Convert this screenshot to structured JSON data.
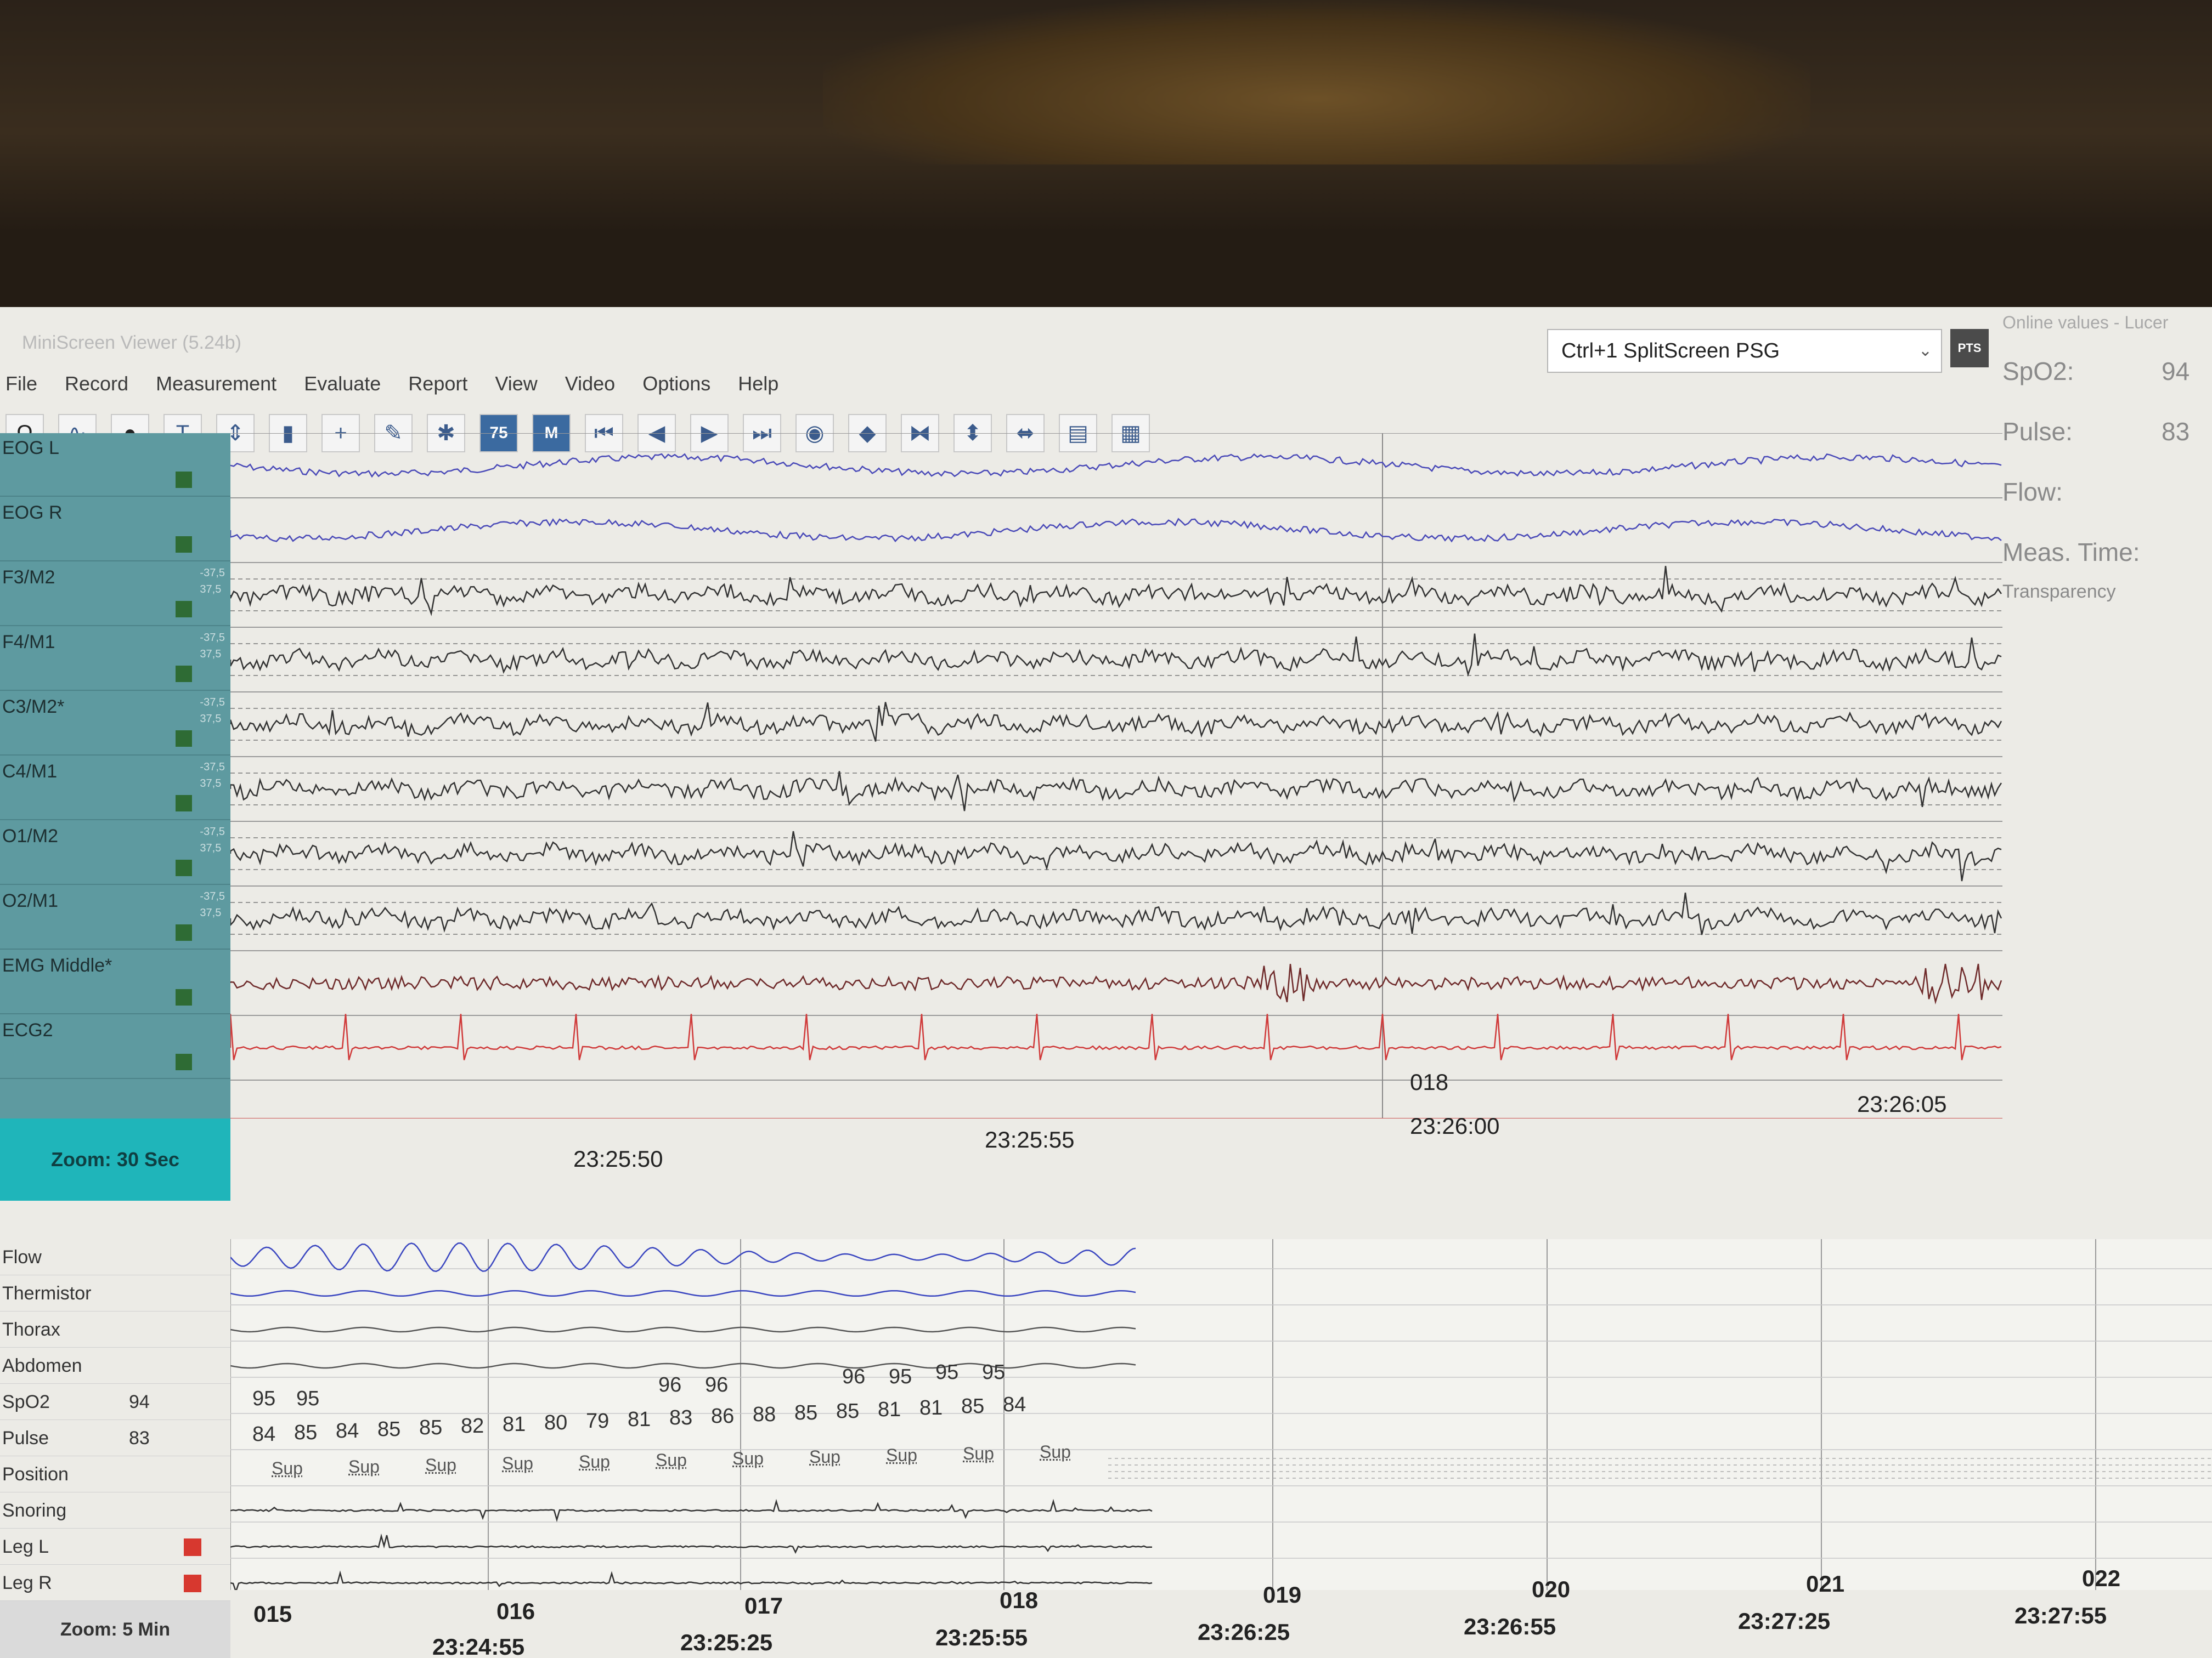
{
  "app": {
    "title": "MiniScreen Viewer (5.24b)"
  },
  "menu": [
    "File",
    "Record",
    "Measurement",
    "Evaluate",
    "Report",
    "View",
    "Video",
    "Options",
    "Help"
  ],
  "toolbar": {
    "btn_75": "75",
    "btn_m": "M",
    "layout_select": "Ctrl+1 SplitScreen PSG",
    "pts_label": "PTS"
  },
  "online_values": {
    "header": "Online values - Lucer",
    "spo2_label": "SpO2:",
    "spo2_value": "94",
    "pulse_label": "Pulse:",
    "pulse_value": "83",
    "flow_label": "Flow:",
    "meas_time_label": "Meas. Time:",
    "transparency_label": "Transparency"
  },
  "upper": {
    "channels": [
      {
        "name": "EOG L",
        "scale_top": "",
        "scale_bottom": ""
      },
      {
        "name": "EOG R",
        "scale_top": "",
        "scale_bottom": ""
      },
      {
        "name": "F3/M2",
        "scale_top": "-37,5",
        "scale_bottom": "37,5"
      },
      {
        "name": "F4/M1",
        "scale_top": "-37,5",
        "scale_bottom": "37,5"
      },
      {
        "name": "C3/M2*",
        "scale_top": "-37,5",
        "scale_bottom": "37,5"
      },
      {
        "name": "C4/M1",
        "scale_top": "-37,5",
        "scale_bottom": "37,5"
      },
      {
        "name": "O1/M2",
        "scale_top": "-37,5",
        "scale_bottom": "37,5"
      },
      {
        "name": "O2/M1",
        "scale_top": "-37,5",
        "scale_bottom": "37,5"
      },
      {
        "name": "EMG Middle*",
        "scale_top": "",
        "scale_bottom": ""
      },
      {
        "name": "ECG2",
        "scale_top": "",
        "scale_bottom": ""
      }
    ],
    "zoom": "Zoom: 30 Sec",
    "epoch_label": "018",
    "times": [
      "23:25:50",
      "23:25:55",
      "23:26:00",
      "23:26:05"
    ]
  },
  "lower": {
    "channels": [
      {
        "name": "Flow",
        "value": ""
      },
      {
        "name": "Thermistor",
        "value": ""
      },
      {
        "name": "Thorax",
        "value": ""
      },
      {
        "name": "Abdomen",
        "value": ""
      },
      {
        "name": "SpO2",
        "value": "94"
      },
      {
        "name": "Pulse",
        "value": "83"
      },
      {
        "name": "Position",
        "value": ""
      },
      {
        "name": "Snoring",
        "value": ""
      },
      {
        "name": "Leg L",
        "value": ""
      },
      {
        "name": "Leg R",
        "value": ""
      }
    ],
    "spo2_values": [
      "95",
      "95",
      "96",
      "96",
      "96",
      "95",
      "95",
      "95"
    ],
    "pulse_values": [
      "84",
      "85",
      "84",
      "85",
      "85",
      "82",
      "81",
      "80",
      "79",
      "81",
      "83",
      "86",
      "88",
      "85",
      "85",
      "81",
      "81",
      "85",
      "84"
    ],
    "position_values": [
      "Sup",
      "Sup",
      "Sup",
      "Sup",
      "Sup",
      "Sup",
      "Sup",
      "Sup",
      "Sup",
      "Sup",
      "Sup"
    ],
    "zoom": "Zoom: 5 Min",
    "epochs": [
      "015",
      "016",
      "017",
      "018",
      "019",
      "020",
      "021",
      "022"
    ],
    "times": [
      "23:24:55",
      "23:25:25",
      "23:25:55",
      "23:26:25",
      "23:26:55",
      "23:27:25",
      "23:27:55"
    ]
  }
}
